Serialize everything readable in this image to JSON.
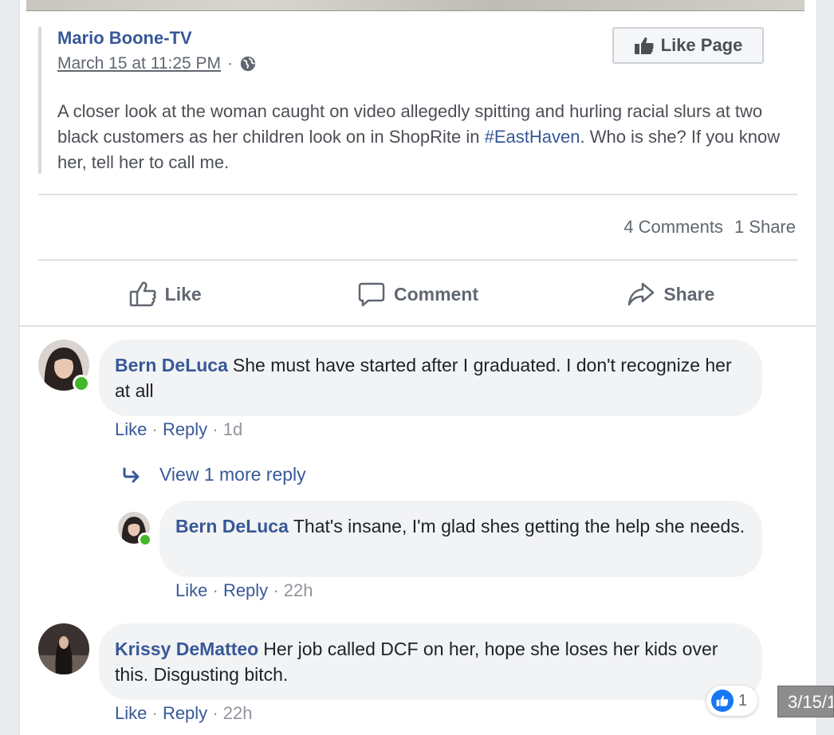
{
  "post": {
    "author": "Mario Boone-TV",
    "date": "March 15 at 11:25 PM",
    "separator": "·",
    "like_page_label": "Like Page",
    "text_before": "A closer look at the woman caught on video allegedly spitting and hurling racial slurs at two black customers as her children look on in ShopRite in ",
    "hashtag": "#EastHaven",
    "text_after": ". Who is she? If you know her, tell her to call me.",
    "comments_count": "4 Comments",
    "shares_count": "1 Share"
  },
  "actions": {
    "like": "Like",
    "comment": "Comment",
    "share": "Share"
  },
  "comments": [
    {
      "name": "Bern DeLuca",
      "text": "She must have started after I graduated. I don't recognize her at all",
      "like": "Like",
      "reply": "Reply",
      "time": "1d"
    },
    {
      "name": "Bern DeLuca",
      "text": "That's insane, I'm glad shes getting the help she needs.",
      "like": "Like",
      "reply": "Reply",
      "time": "22h"
    },
    {
      "name": "Krissy DeMatteo",
      "text": "Her job called DCF on her, hope she loses her kids over this. Disgusting bitch.",
      "like": "Like",
      "reply": "Reply",
      "time": "22h"
    }
  ],
  "view_more_replies": "View 1 more reply",
  "reaction_count": "1",
  "date_tag": "3/15/1",
  "colors": {
    "link_blue": "#385898",
    "online_green": "#42b72a",
    "bubble_bg": "#f2f3f5",
    "reaction_blue": "#1877f2"
  }
}
